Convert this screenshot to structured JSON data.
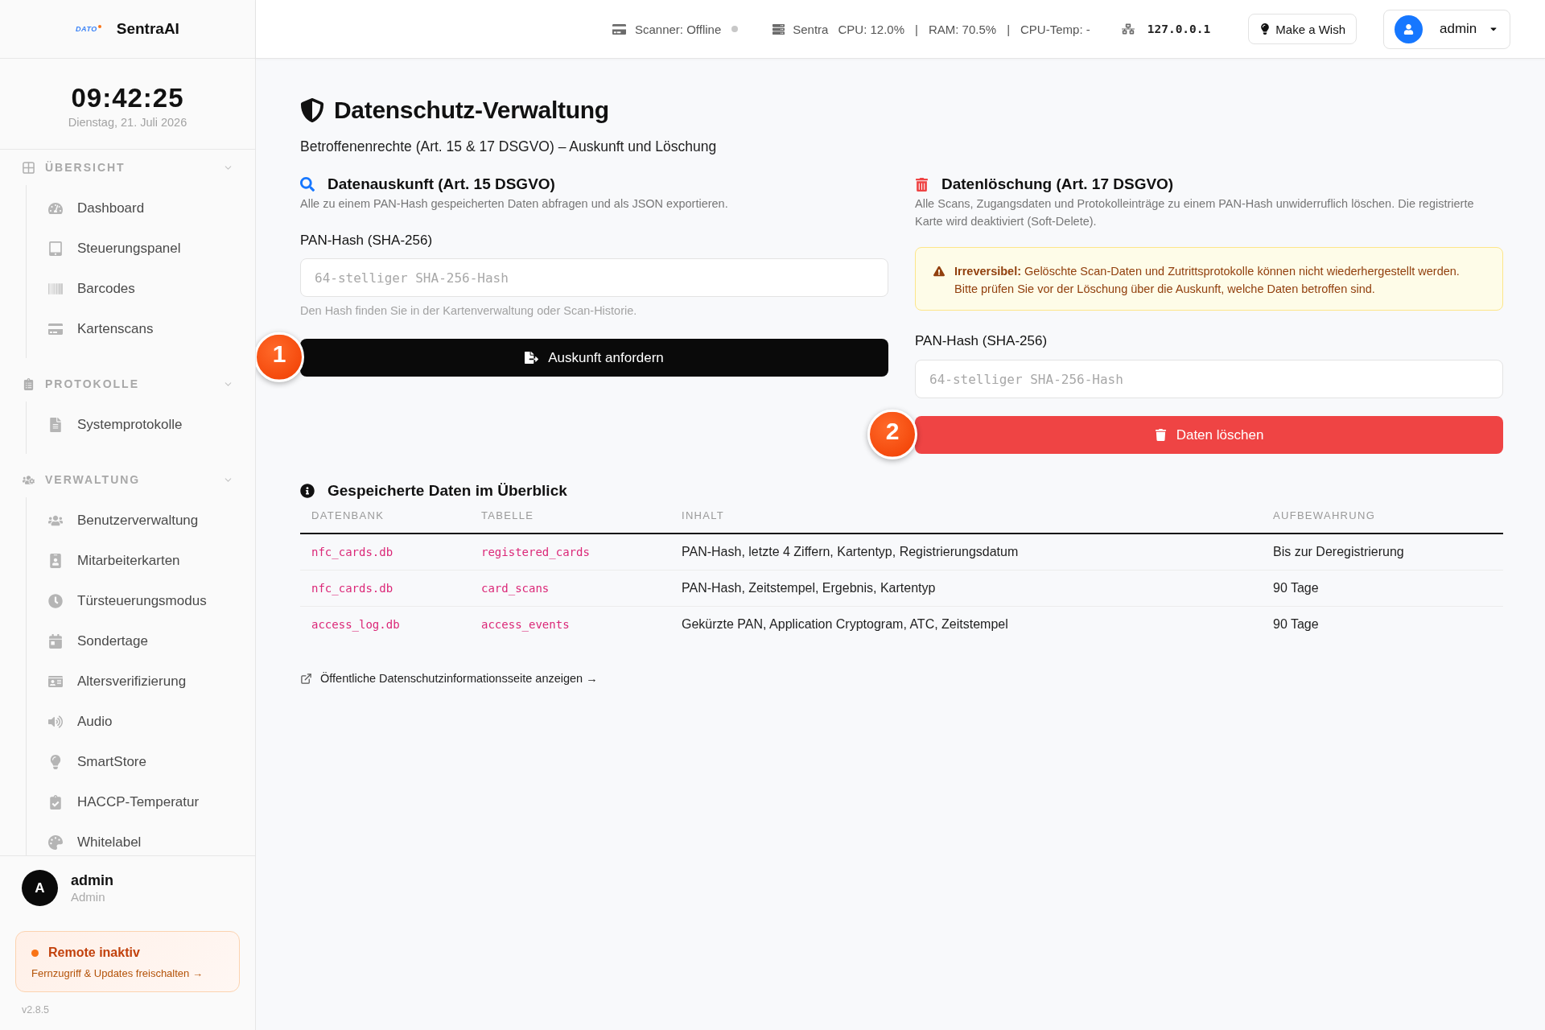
{
  "sidebar": {
    "logo_text": "DATO",
    "brand": "SentraAI",
    "clock": {
      "time": "09:42:25",
      "date": "Dienstag, 21. Juli 2026"
    },
    "sections": [
      {
        "title": "ÜBERSICHT",
        "expanded": true,
        "items": [
          {
            "label": "Dashboard",
            "selected": false
          },
          {
            "label": "Steuerungspanel",
            "selected": false
          },
          {
            "label": "Barcodes",
            "selected": false
          },
          {
            "label": "Kartenscans",
            "selected": false
          }
        ]
      },
      {
        "title": "PROTOKOLLE",
        "expanded": true,
        "items": [
          {
            "label": "Systemprotokolle",
            "selected": false
          }
        ]
      },
      {
        "title": "VERWALTUNG",
        "expanded": true,
        "items": [
          {
            "label": "Benutzerverwaltung",
            "selected": false
          },
          {
            "label": "Mitarbeiterkarten",
            "selected": false
          },
          {
            "label": "Türsteuerungsmodus",
            "selected": false
          },
          {
            "label": "Sondertage",
            "selected": false
          },
          {
            "label": "Altersverifizierung",
            "selected": false
          },
          {
            "label": "Audio",
            "selected": false
          },
          {
            "label": "SmartStore",
            "selected": false
          },
          {
            "label": "HACCP-Temperatur",
            "selected": false
          },
          {
            "label": "Whitelabel",
            "selected": false
          }
        ]
      }
    ],
    "user": {
      "initial": "A",
      "name": "admin",
      "role": "Admin"
    },
    "remote": {
      "active": false,
      "title": "Remote inaktiv",
      "link": "Fernzugriff & Updates freischalten →"
    },
    "version": "v2.8.5"
  },
  "topbar": {
    "scanner": {
      "label": "Scanner: Offline",
      "online": false
    },
    "system": {
      "name": "Sentra",
      "stats": [
        "CPU: 12.0%",
        "|",
        "RAM: 70.5%",
        "|",
        "CPU-Temp: -"
      ]
    },
    "ip": "127.0.0.1",
    "wish_button": "Make a Wish",
    "user_menu": {
      "name": "admin"
    }
  },
  "page": {
    "title": "Datenschutz-Verwaltung",
    "subtitle": "Betroffenenrechte (Art. 15 & 17 DSGVO) – Auskunft und Löschung",
    "inquiry": {
      "title": "Datenauskunft (Art. 15 DSGVO)",
      "description": "Alle zu einem PAN-Hash gespeicherten Daten abfragen und als JSON exportieren.",
      "field_label": "PAN-Hash (SHA-256)",
      "placeholder": "64-stelliger SHA-256-Hash",
      "hint": "Den Hash finden Sie in der Kartenverwaltung oder Scan-Historie.",
      "button": "Auskunft anfordern",
      "marker": "1"
    },
    "deletion": {
      "title": "Datenlöschung (Art. 17 DSGVO)",
      "description": "Alle Scans, Zugangsdaten und Protokolleinträge zu einem PAN-Hash unwiderruflich löschen. Die registrierte Karte wird deaktiviert (Soft-Delete).",
      "warning": "**Irreversibel:** Gelöschte Scan-Daten und Zutrittsprotokolle können nicht wiederhergestellt werden. Bitte prüfen Sie vor der Löschung über die Auskunft, welche Daten betroffen sind.",
      "field_label": "PAN-Hash (SHA-256)",
      "placeholder": "64-stelliger SHA-256-Hash",
      "button": "Daten löschen",
      "marker": "2"
    },
    "overview": {
      "title": "Gespeicherte Daten im Überblick",
      "table": {
        "columns": [
          "DATENBANK",
          "TABELLE",
          "INHALT",
          "AUFBEWAHRUNG"
        ],
        "rows": [
          [
            "nfc_cards.db",
            "registered_cards",
            "PAN-Hash, letzte 4 Ziffern, Kartentyp, Registrierungsdatum",
            "Bis zur Deregistrierung"
          ],
          [
            "nfc_cards.db",
            "card_scans",
            "PAN-Hash, Zeitstempel, Ergebnis, Kartentyp",
            "90 Tage"
          ],
          [
            "access_log.db",
            "access_events",
            "Gekürzte PAN, Application Cryptogram, ATC, Zeitstempel",
            "90 Tage"
          ]
        ]
      }
    },
    "link": "Öffentliche Datenschutzinformationsseite anzeigen →"
  }
}
